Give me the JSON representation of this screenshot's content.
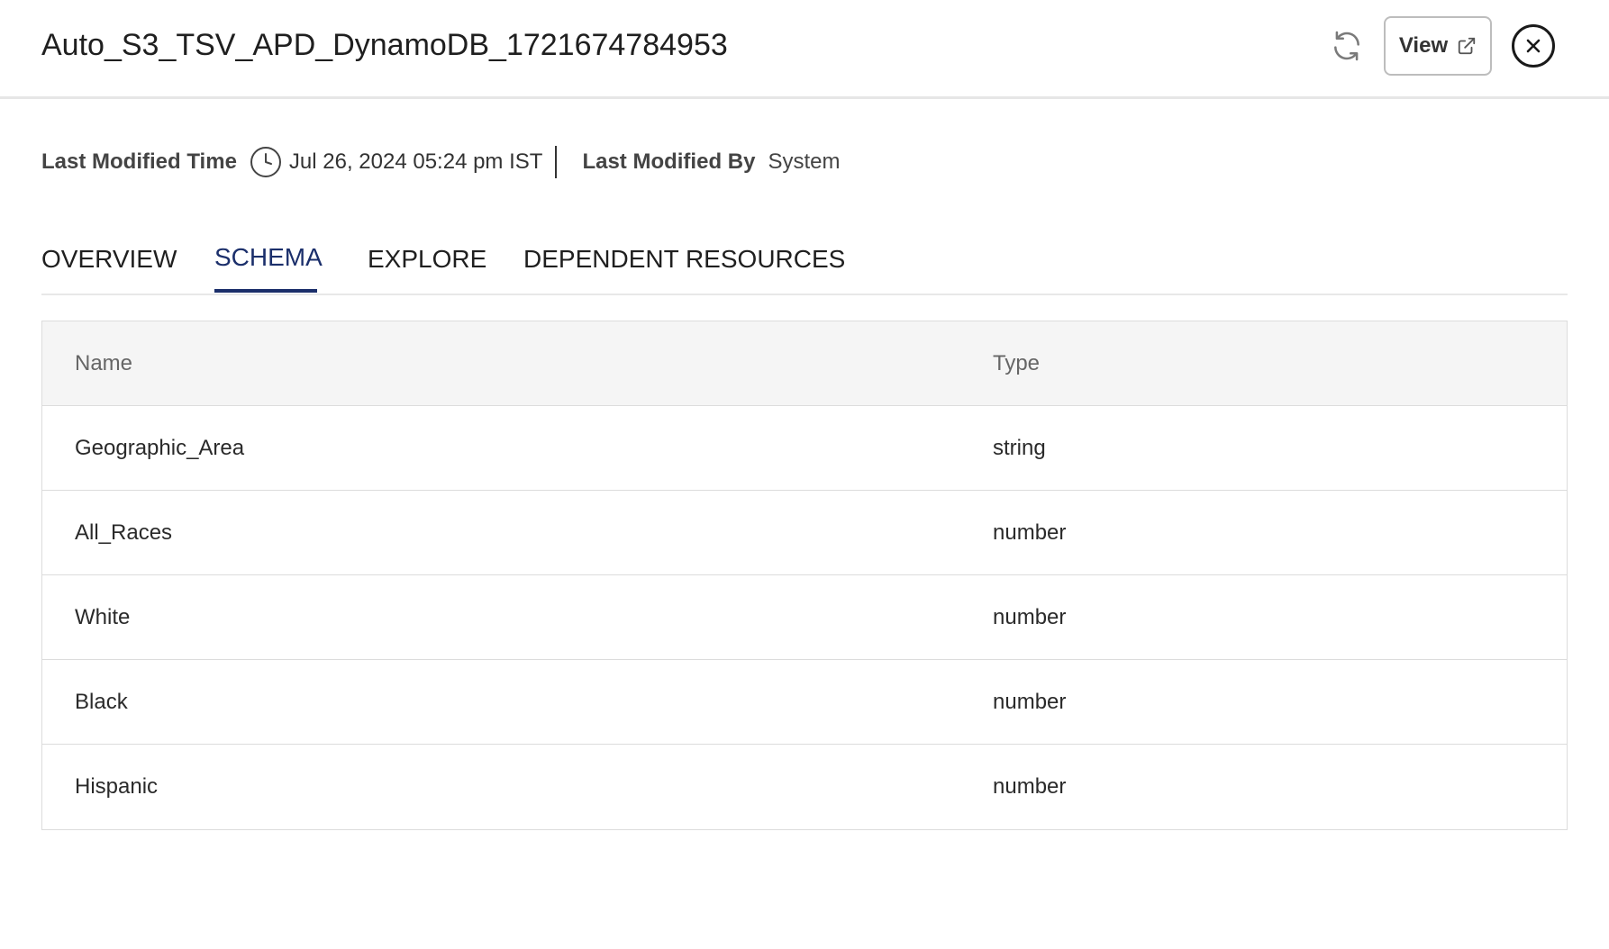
{
  "header": {
    "title": "Auto_S3_TSV_APD_DynamoDB_1721674784953",
    "refresh_icon": "refresh-icon",
    "view_label": "View",
    "view_icon": "external-link-icon",
    "close_icon": "close-icon"
  },
  "meta": {
    "modified_time_label": "Last Modified Time",
    "modified_time_value": "Jul 26, 2024 05:24 pm IST",
    "modified_by_label": "Last Modified By",
    "modified_by_value": "System",
    "clock_icon": "clock-icon"
  },
  "tabs": [
    {
      "label": "OVERVIEW",
      "active": false
    },
    {
      "label": "SCHEMA",
      "active": true
    },
    {
      "label": "EXPLORE",
      "active": false
    },
    {
      "label": "DEPENDENT RESOURCES",
      "active": false
    }
  ],
  "table": {
    "columns": [
      "Name",
      "Type"
    ],
    "rows": [
      {
        "name": "Geographic_Area",
        "type": "string"
      },
      {
        "name": "All_Races",
        "type": "number"
      },
      {
        "name": "White",
        "type": "number"
      },
      {
        "name": "Black",
        "type": "number"
      },
      {
        "name": "Hispanic",
        "type": "number"
      }
    ]
  },
  "colors": {
    "accent": "#1b2f6b",
    "header_bg": "#f5f5f5",
    "border": "#dcdcdc"
  }
}
